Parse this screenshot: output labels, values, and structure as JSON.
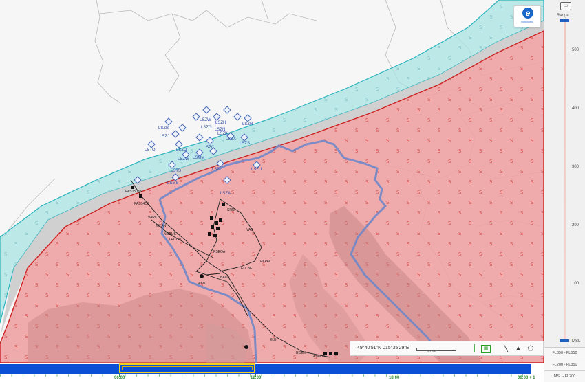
{
  "map": {
    "airports": [
      {
        "code": "LSZR"
      },
      {
        "code": "LSZH"
      },
      {
        "code": "LSZW"
      },
      {
        "code": "LSZN"
      },
      {
        "code": "LSZG"
      },
      {
        "code": "LSZK"
      },
      {
        "code": "LSZB"
      },
      {
        "code": "LSZJ"
      },
      {
        "code": "LSZC"
      },
      {
        "code": "LSZX"
      },
      {
        "code": "LSZS"
      },
      {
        "code": "LSMM"
      },
      {
        "code": "LSTO"
      },
      {
        "code": "LSZW"
      },
      {
        "code": "LSTS"
      },
      {
        "code": "LSMS"
      },
      {
        "code": "LSZL"
      },
      {
        "code": "LSZA"
      },
      {
        "code": "LSZD"
      },
      {
        "code": "LSZU"
      }
    ],
    "route_labels": [
      "PAS1503A",
      "PAS14C0",
      "VARIO",
      "MILAN",
      "NOBUS",
      "SRN",
      "PSEOA",
      "LECOD",
      "VAS",
      "ELCBE",
      "EKPAL",
      "BALO",
      "ABN",
      "ELB",
      "BISEK",
      "ANFON"
    ],
    "sigmet_symbol": "S"
  },
  "logo": {
    "mark": "e",
    "text": "eurocontrol"
  },
  "vertical_panel": {
    "range_label": "Range",
    "ticks": [
      "500",
      "400",
      "300",
      "200",
      "100",
      "MSL"
    ],
    "fl_buttons": [
      "FL350 - FL550",
      "FL200 - FL350",
      "MSL - FL200"
    ]
  },
  "coordinates": {
    "text": "49°40'51\"N 015°35'29\"E",
    "scale_label": "50 NM"
  },
  "toolbar": {
    "icons": [
      "green-bar-icon",
      "calendar-icon",
      "ruler-icon",
      "mountain-icon",
      "polygon-icon"
    ]
  },
  "timeline": {
    "labels": [
      "06:00",
      "12:00",
      "18:00",
      "00:00 + 1"
    ]
  }
}
